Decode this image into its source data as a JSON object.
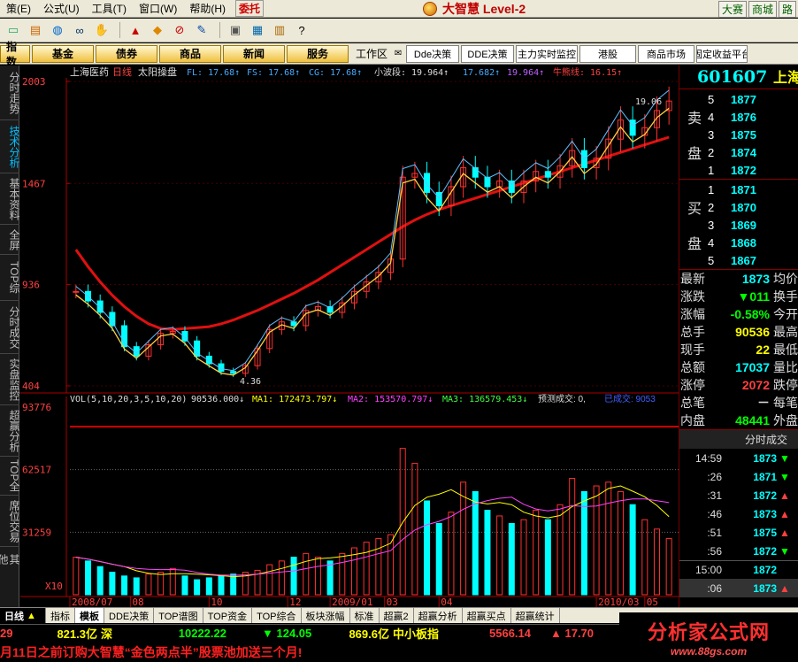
{
  "menubar": {
    "items": [
      "策(E)",
      "公式(U)",
      "工具(T)",
      "窗口(W)",
      "帮助(H)"
    ],
    "highlight": "委托",
    "brand": "大智慧 Level-2",
    "right": [
      "大赛",
      "商城",
      "路"
    ]
  },
  "tabbar": {
    "tabs": [
      "指数",
      "基金",
      "债券",
      "商品",
      "新闻",
      "服务"
    ],
    "workarea": "工作区",
    "plain": [
      "Dde决策",
      "DDE决策",
      "主力实时监控",
      "港股",
      "商品市场",
      "固定收益平台"
    ]
  },
  "sidebar": {
    "items": [
      "分时走势",
      "技术分析",
      "基本资料",
      "全屏",
      "TOP综",
      "分时成交",
      "实盘监控",
      "超赢分析",
      "TOP全",
      "席位交易",
      "其他"
    ],
    "active": 1
  },
  "chart_data": [
    {
      "type": "candlestick",
      "header": {
        "name": "上海医药",
        "period": "日线",
        "indicator": "太阳操盘",
        "fl": "FL: 17.68↑",
        "fs": "FS: 17.68↑",
        "cg": "CG: 17.68↑",
        "xbd": "小波段: 19.964↑",
        "v1": "17.682↑",
        "v2": "19.964↑",
        "nxx": "牛熊线: 16.15↑"
      },
      "yticks": [
        "2003",
        "1467",
        "936",
        "404"
      ],
      "ylim": [
        404,
        2003
      ],
      "annotations": {
        "high": "19.06",
        "low": "4.36"
      },
      "xticks": [
        "2008/07",
        "08",
        "10",
        "12",
        "2009/01",
        "03",
        "04",
        "2010/03",
        "05"
      ],
      "close": [
        900,
        850,
        790,
        720,
        610,
        560,
        620,
        680,
        690,
        640,
        560,
        520,
        480,
        470,
        510,
        600,
        700,
        740,
        720,
        800,
        820,
        790,
        840,
        900,
        950,
        1000,
        1070,
        1500,
        1520,
        1420,
        1350,
        1450,
        1550,
        1500,
        1450,
        1480,
        1420,
        1480,
        1530,
        1500,
        1560,
        1640,
        1550,
        1600,
        1700,
        1800,
        1720,
        1760,
        1850,
        1900
      ],
      "red_line": [
        1120,
        1030,
        950,
        880,
        820,
        770,
        730,
        705,
        700,
        705,
        710,
        715,
        730,
        750,
        775,
        800,
        830,
        860,
        890,
        925,
        960,
        1000,
        1040,
        1080,
        1120,
        1160,
        1200,
        1240,
        1275,
        1305,
        1330,
        1350,
        1370,
        1390,
        1410,
        1430,
        1450,
        1470,
        1490,
        1510,
        1530,
        1550,
        1570,
        1590,
        1610,
        1630,
        1650,
        1670,
        1690,
        1710
      ]
    },
    {
      "type": "bar",
      "title": "VOL(5,10,20,3,5,10,20)",
      "vol": "90536.000↓",
      "ma1": "MA1: 172473.797↓",
      "ma2": "MA2: 153570.797↓",
      "ma3": "MA3: 136579.453↓",
      "forecast": "预测成交: 0,",
      "extra": "已成交: 9053",
      "yticks": [
        "93776",
        "62517",
        "31259"
      ],
      "unit": "X10",
      "ylim": [
        0,
        93776
      ],
      "values": [
        20,
        18,
        15,
        12,
        10,
        9,
        11,
        12,
        14,
        10,
        8,
        9,
        10,
        11,
        12,
        13,
        16,
        18,
        20,
        22,
        20,
        18,
        22,
        25,
        28,
        30,
        32,
        78,
        70,
        50,
        38,
        44,
        60,
        55,
        45,
        42,
        38,
        40,
        45,
        40,
        48,
        62,
        55,
        58,
        60,
        55,
        48,
        40,
        35,
        30
      ]
    }
  ],
  "quote": {
    "code": "601607",
    "name": "上海",
    "sell_label": "卖盘",
    "buy_label": "买盘",
    "sell": [
      {
        "n": "5",
        "p": "1877"
      },
      {
        "n": "4",
        "p": "1876"
      },
      {
        "n": "3",
        "p": "1875"
      },
      {
        "n": "2",
        "p": "1874"
      },
      {
        "n": "1",
        "p": "1872"
      }
    ],
    "buy": [
      {
        "n": "1",
        "p": "1871"
      },
      {
        "n": "2",
        "p": "1870"
      },
      {
        "n": "3",
        "p": "1869"
      },
      {
        "n": "4",
        "p": "1868"
      },
      {
        "n": "5",
        "p": "1867"
      }
    ],
    "stats": [
      {
        "k": "最新",
        "v": "1873",
        "c": "#00ffff",
        "k2": "均价"
      },
      {
        "k": "涨跌",
        "v": "▼011",
        "c": "#00ff00",
        "k2": "换手"
      },
      {
        "k": "涨幅",
        "v": "-0.58%",
        "c": "#00ff00",
        "k2": "今开"
      },
      {
        "k": "总手",
        "v": "90536",
        "c": "#ffff00",
        "k2": "最高"
      },
      {
        "k": "现手",
        "v": "22",
        "c": "#ffff00",
        "k2": "最低"
      },
      {
        "k": "总额",
        "v": "17037",
        "c": "#00ffff",
        "k2": "量比"
      },
      {
        "k": "涨停",
        "v": "2072",
        "c": "#ff4040",
        "k2": "跌停"
      },
      {
        "k": "总笔",
        "v": "－",
        "c": "#dddddd",
        "k2": "每笔"
      },
      {
        "k": "内盘",
        "v": "48441",
        "c": "#00ff00",
        "k2": "外盘"
      }
    ],
    "ts_title": "分时成交",
    "ts": [
      {
        "t": "14:59",
        "p": "1873",
        "a": "▼",
        "c": "#00ff00"
      },
      {
        "t": ":26",
        "p": "1871",
        "a": "▼",
        "c": "#00ff00"
      },
      {
        "t": ":31",
        "p": "1872",
        "a": "▲",
        "c": "#ff4040"
      },
      {
        "t": ":46",
        "p": "1873",
        "a": "▲",
        "c": "#ff4040"
      },
      {
        "t": ":51",
        "p": "1875",
        "a": "▲",
        "c": "#ff4040"
      },
      {
        "t": ":56",
        "p": "1872",
        "a": "▼",
        "c": "#00ff00"
      },
      {
        "t": "15:00",
        "p": "1872",
        "a": "",
        "c": "#000"
      },
      {
        "t": ":06",
        "p": "1873",
        "a": "▲",
        "c": "#ff4040"
      }
    ]
  },
  "bottom_tabs": [
    "指标",
    "模板",
    "DDE决策",
    "TOP谱图",
    "TOP资金",
    "TOP综合",
    "板块涨幅",
    "标准",
    "超赢2",
    "超赢分析",
    "超赢买点",
    "超赢统计"
  ],
  "bottom_tab_active": 1,
  "period_label": "日线",
  "status": {
    "a": "29",
    "b": "821.3亿",
    "c": "深",
    "d": "10222.22",
    "e": "▼ 124.05",
    "f": "869.6亿",
    "g": "中小板指",
    "h": "5566.14",
    "i": "▲ 17.70"
  },
  "ticker": "月11日之前订购大智慧“金色两点半”股票池加送三个月!",
  "watermark": {
    "title": "分析家公式网",
    "url": "www.88gs.com"
  }
}
